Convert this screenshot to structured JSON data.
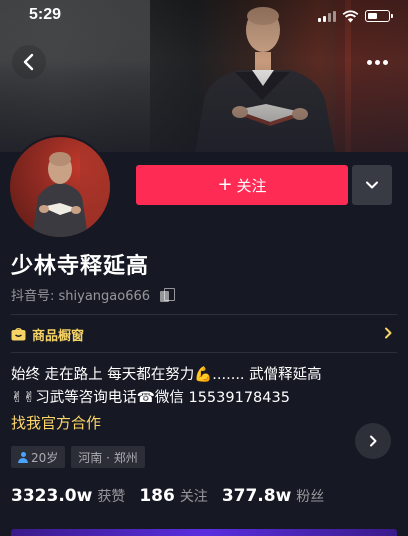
{
  "status_bar": {
    "time": "5:29"
  },
  "profile": {
    "name": "少林寺释延高",
    "douyin_id": "抖音号: shiyangao666",
    "follow_label": "关注"
  },
  "shop_window": {
    "label": "商品橱窗"
  },
  "bio": {
    "line1": "始终   走在路上   每天都在努力💪....... 武僧释延高",
    "line2": "✌✌习武等咨询电话☎微信 15539178435",
    "cooperation_link": "找我官方合作"
  },
  "tags": {
    "age": "20岁",
    "location": "河南 · 郑州"
  },
  "stats": {
    "likes_value": "3323.0w",
    "likes_label": "获赞",
    "following_value": "186",
    "following_label": "关注",
    "fans_value": "377.8w",
    "fans_label": "粉丝"
  },
  "colors": {
    "follow_button": "#fe2c55",
    "link_text": "#ffd66b",
    "background": "#161823"
  },
  "icons": [
    "back-arrow-icon",
    "more-dots-icon",
    "dropdown-chevron-icon",
    "copy-icon",
    "shop-icon",
    "chevron-right-icon",
    "person-icon",
    "wifi-icon",
    "battery-icon",
    "signal-icon"
  ]
}
